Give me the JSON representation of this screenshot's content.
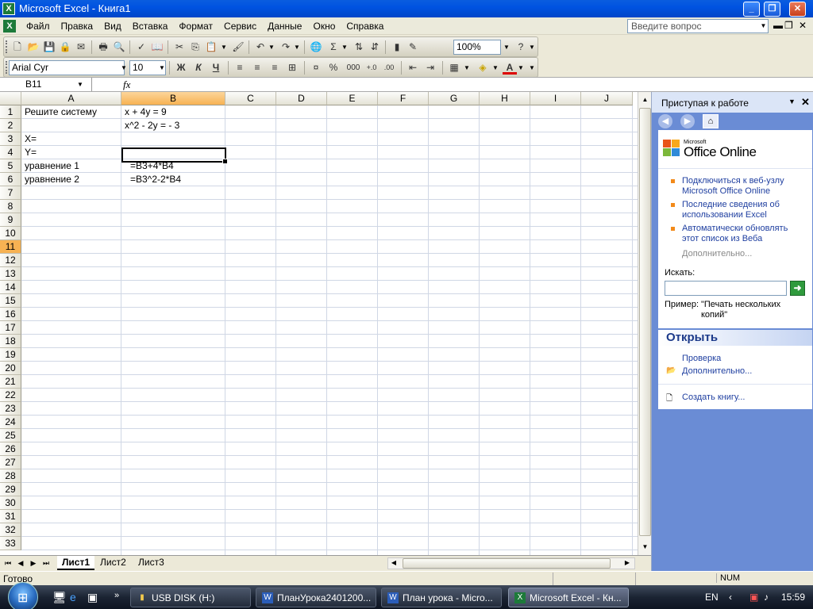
{
  "window": {
    "title": "Microsoft Excel - Книга1"
  },
  "menu": [
    "Файл",
    "Правка",
    "Вид",
    "Вставка",
    "Формат",
    "Сервис",
    "Данные",
    "Окно",
    "Справка"
  ],
  "help_box": {
    "placeholder": "Введите вопрос"
  },
  "toolbar_standard": {
    "zoom": "100%"
  },
  "toolbar_format": {
    "font_name": "Arial Cyr",
    "font_size": "10",
    "bold": "Ж",
    "italic": "К",
    "underline": "Ч",
    "percent": "%",
    "thousands": "000",
    "font_color_letter": "A"
  },
  "formula_bar": {
    "name_box": "B11",
    "fx": "fx",
    "value": ""
  },
  "grid": {
    "columns": [
      "A",
      "B",
      "C",
      "D",
      "E",
      "F",
      "G",
      "H",
      "I",
      "J"
    ],
    "rows": [
      "1",
      "2",
      "3",
      "4",
      "5",
      "6",
      "7",
      "8",
      "9",
      "10",
      "11",
      "12",
      "13",
      "14",
      "15",
      "16",
      "17",
      "18",
      "19",
      "20",
      "21",
      "22",
      "23",
      "24",
      "25",
      "26",
      "27",
      "28",
      "29",
      "30",
      "31",
      "32",
      "33"
    ],
    "cells": {
      "A1": "Решите систему",
      "B1": "x + 4y = 9",
      "B2": "x^2 - 2y = - 3",
      "A3": "X=",
      "A4": "Y=",
      "A5": "уравнение 1",
      "B5": "=B3+4*B4",
      "A6": "уравнение 2",
      "B6": "=B3^2-2*B4"
    },
    "active_cell": "B11"
  },
  "sheets": {
    "tabs": [
      "Лист1",
      "Лист2",
      "Лист3"
    ],
    "active": "Лист1"
  },
  "status": {
    "text": "Готово",
    "num": "NUM"
  },
  "task_pane": {
    "title": "Приступая к работе",
    "logo_small": "Microsoft",
    "logo_big": "Office Online",
    "links": [
      "Подключиться к веб-узлу Microsoft Office Online",
      "Последние сведения об использовании Excel",
      "Автоматически обновлять этот список из Веба"
    ],
    "more": "Дополнительно...",
    "search_label": "Искать:",
    "example_label": "Пример:",
    "example_text": "\"Печать нескольких копий\"",
    "open_title": "Открыть",
    "open_items": [
      "Проверка",
      "Дополнительно..."
    ],
    "create": "Создать книгу..."
  },
  "taskbar": {
    "buttons": [
      "USB DISK (H:)",
      "ПланУрока2401200...",
      "План урока - Micro...",
      "Microsoft Excel - Кн..."
    ],
    "lang": "EN",
    "clock": "15:59"
  }
}
